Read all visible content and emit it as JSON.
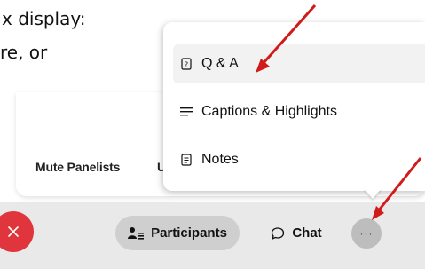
{
  "document": {
    "line1": "x display:",
    "line2": "re, or"
  },
  "panel": {
    "mute_panelists": "Mute Panelists",
    "clipped_button": "U"
  },
  "menu": {
    "items": [
      {
        "label": "Q & A",
        "icon": "qa-icon",
        "highlighted": true
      },
      {
        "label": "Captions & Highlights",
        "icon": "captions-icon",
        "highlighted": false
      },
      {
        "label": "Notes",
        "icon": "notes-icon",
        "highlighted": false
      }
    ]
  },
  "toolbar": {
    "leave_icon": "close-icon",
    "participants_label": "Participants",
    "chat_label": "Chat",
    "more_label": "···"
  },
  "colors": {
    "annotation_arrow": "#d11a1a",
    "leave_button": "#e0353c",
    "toolbar_bg": "#e9e9e9",
    "participants_bg": "#cfcfcf",
    "more_bg": "#bdbdbd"
  }
}
